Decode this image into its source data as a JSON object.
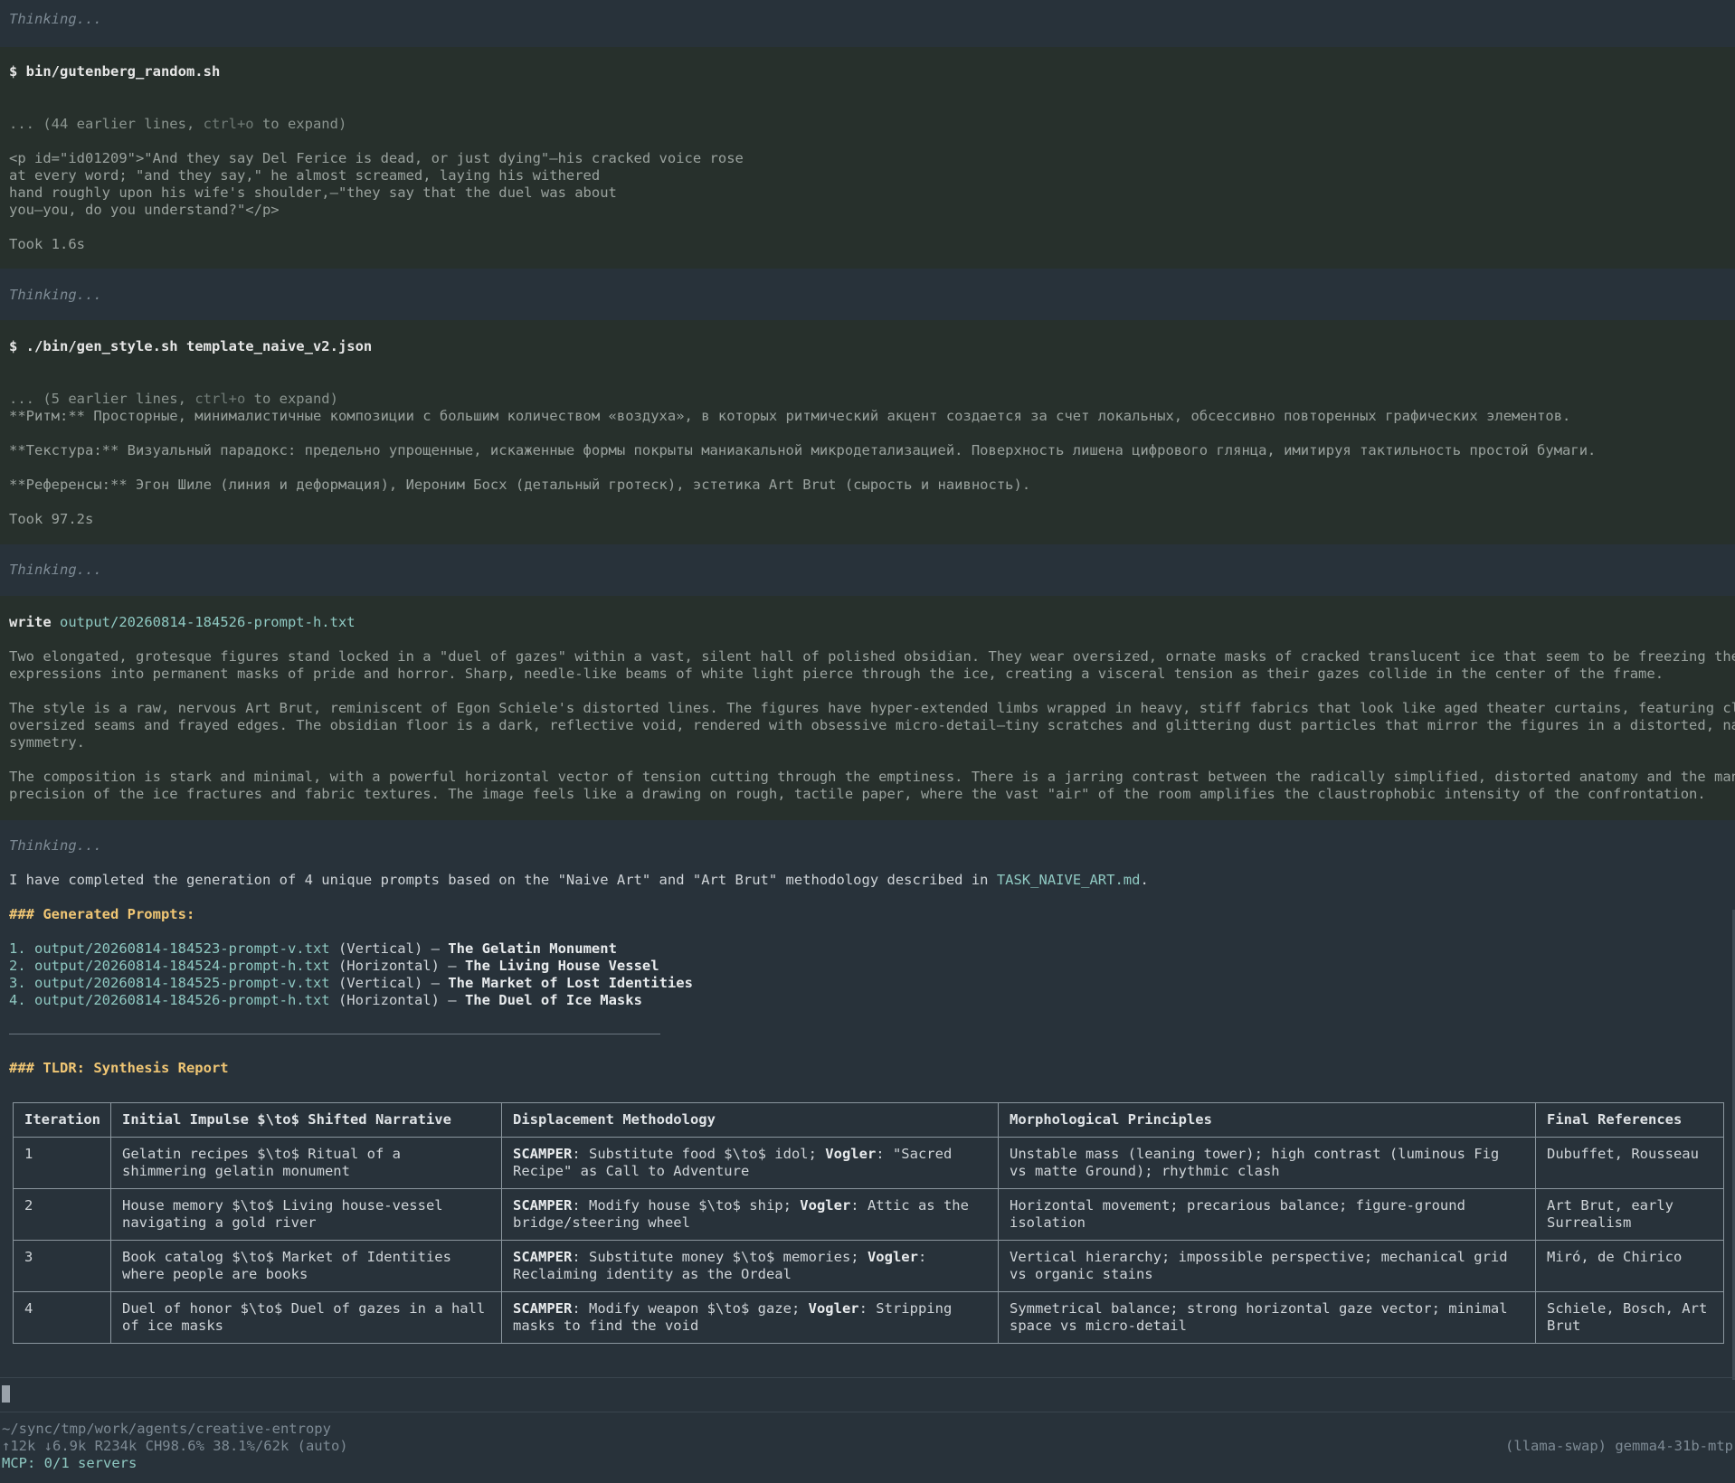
{
  "blocks": {
    "thinking_label": "Thinking...",
    "tool1": {
      "command": "$ bin/gutenberg_random.sh",
      "expand_prefix": "... (44 earlier lines, ",
      "expand_key": "ctrl+o",
      "expand_suffix": " to expand)",
      "output": [
        "<p id=\"id01209\">\"And they say Del Ferice is dead, or just dying\"—his cracked voice rose",
        "at every word; \"and they say,\" he almost screamed, laying his withered",
        "hand roughly upon his wife's shoulder,—\"they say that the duel was about",
        "you—you, do you understand?\"</p>"
      ],
      "took": "Took 1.6s"
    },
    "tool2": {
      "command": "$ ./bin/gen_style.sh template_naive_v2.json",
      "expand_prefix": "... (5 earlier lines, ",
      "expand_key": "ctrl+o",
      "expand_suffix": " to expand)",
      "output": [
        "**Ритм:** Просторные, минималистичные композиции с большим количеством «воздуха», в которых ритмический акцент создается за счет локальных, обсессивно повторенных графических элементов.",
        "",
        "**Текстура:** Визуальный парадокс: предельно упрощенные, искаженные формы покрыты маниакальной микродетализацией. Поверхность лишена цифрового глянца, имитируя тактильность простой бумаги.",
        "",
        "**Референсы:** Эгон Шиле (линия и деформация), Иероним Босх (детальный гротеск), эстетика Art Brut (сырость и наивность)."
      ],
      "took": "Took 97.2s"
    },
    "tool3": {
      "verb": "write",
      "path": "output/20260814-184526-prompt-h.txt",
      "output": [
        "Two elongated, grotesque figures stand locked in a \"duel of gazes\" within a vast, silent hall of polished obsidian. They wear oversized, ornate masks of cracked translucent ice that seem to be freezing their",
        "expressions into permanent masks of pride and horror. Sharp, needle-like beams of white light pierce through the ice, creating a visceral tension as their gazes collide in the center of the frame.",
        "",
        "The style is a raw, nervous Art Brut, reminiscent of Egon Schiele's distorted lines. The figures have hyper-extended limbs wrapped in heavy, stiff fabrics that look like aged theater curtains, featuring clumsy,",
        "oversized seams and frayed edges. The obsidian floor is a dark, reflective void, rendered with obsessive micro-detail—tiny scratches and glittering dust particles that mirror the figures in a distorted, naive",
        "symmetry.",
        "",
        "The composition is stark and minimal, with a powerful horizontal vector of tension cutting through the emptiness. There is a jarring contrast between the radically simplified, distorted anatomy and the manic",
        "precision of the ice fractures and fabric textures. The image feels like a drawing on rough, tactile paper, where the vast \"air\" of the room amplifies the claustrophobic intensity of the confrontation."
      ]
    }
  },
  "assistant": {
    "intro_prefix": "I have completed the generation of 4 unique prompts based on the \"Naive Art\" and \"Art Brut\" methodology described in ",
    "intro_file": "TASK_NAIVE_ART.md",
    "intro_suffix": ".",
    "generated_heading": "### Generated Prompts:",
    "prompts": [
      {
        "num": "1. ",
        "path": "output/20260814-184523-prompt-v.txt",
        "orient": " (Vertical) – ",
        "title": "The Gelatin Monument"
      },
      {
        "num": "2. ",
        "path": "output/20260814-184524-prompt-h.txt",
        "orient": " (Horizontal) – ",
        "title": "The Living House Vessel"
      },
      {
        "num": "3. ",
        "path": "output/20260814-184525-prompt-v.txt",
        "orient": " (Vertical) – ",
        "title": "The Market of Lost Identities"
      },
      {
        "num": "4. ",
        "path": "output/20260814-184526-prompt-h.txt",
        "orient": " (Horizontal) – ",
        "title": "The Duel of Ice Masks"
      }
    ],
    "tldr_heading": "### TLDR: Synthesis Report",
    "table": {
      "headers": [
        "Iteration",
        "Initial Impulse $\\to$ Shifted Narrative",
        "Displacement Methodology",
        "Morphological Principles",
        "Final References"
      ],
      "rows": [
        {
          "iteration": "1",
          "impulse": "Gelatin recipes $\\to$ Ritual of a shimmering gelatin monument",
          "m_a": "SCAMPER",
          "m_b": ": Substitute food $\\to$ idol; ",
          "m_c": "Vogler",
          "m_d": ": \"Sacred Recipe\" as Call to Adventure",
          "principles": "Unstable mass (leaning tower); high contrast (luminous Fig vs matte Ground); rhythmic clash",
          "refs": "Dubuffet, Rousseau"
        },
        {
          "iteration": "2",
          "impulse": "House memory $\\to$ Living house-vessel navigating a gold river",
          "m_a": "SCAMPER",
          "m_b": ": Modify house $\\to$ ship; ",
          "m_c": "Vogler",
          "m_d": ": Attic as the bridge/steering wheel",
          "principles": "Horizontal movement; precarious balance; figure-ground isolation",
          "refs": "Art Brut, early Surrealism"
        },
        {
          "iteration": "3",
          "impulse": "Book catalog $\\to$ Market of Identities where people are books",
          "m_a": "SCAMPER",
          "m_b": ": Substitute money $\\to$ memories; ",
          "m_c": "Vogler",
          "m_d": ": Reclaiming identity as the Ordeal",
          "principles": "Vertical hierarchy; impossible perspective; mechanical grid vs organic stains",
          "refs": "Miró, de Chirico"
        },
        {
          "iteration": "4",
          "impulse": "Duel of honor $\\to$ Duel of gazes in a hall of ice masks",
          "m_a": "SCAMPER",
          "m_b": ": Modify weapon $\\to$ gaze; ",
          "m_c": "Vogler",
          "m_d": ": Stripping masks to find the void",
          "principles": "Symmetrical balance; strong horizontal gaze vector; minimal space vs micro-detail",
          "refs": "Schiele, Bosch, Art Brut"
        }
      ]
    }
  },
  "status": {
    "cwd": "~/sync/tmp/work/agents/creative-entropy",
    "stats": "↑12k ↓6.9k R234k CH98.6% 38.1%/62k (auto)",
    "model": "(llama-swap) gemma4-31b-mtp",
    "mcp": "MCP: 0/1 servers"
  },
  "colors": {
    "background": "#28323a",
    "tool_background": "#27302c",
    "heading": "#f0c674",
    "path": "#8fc9c2"
  }
}
